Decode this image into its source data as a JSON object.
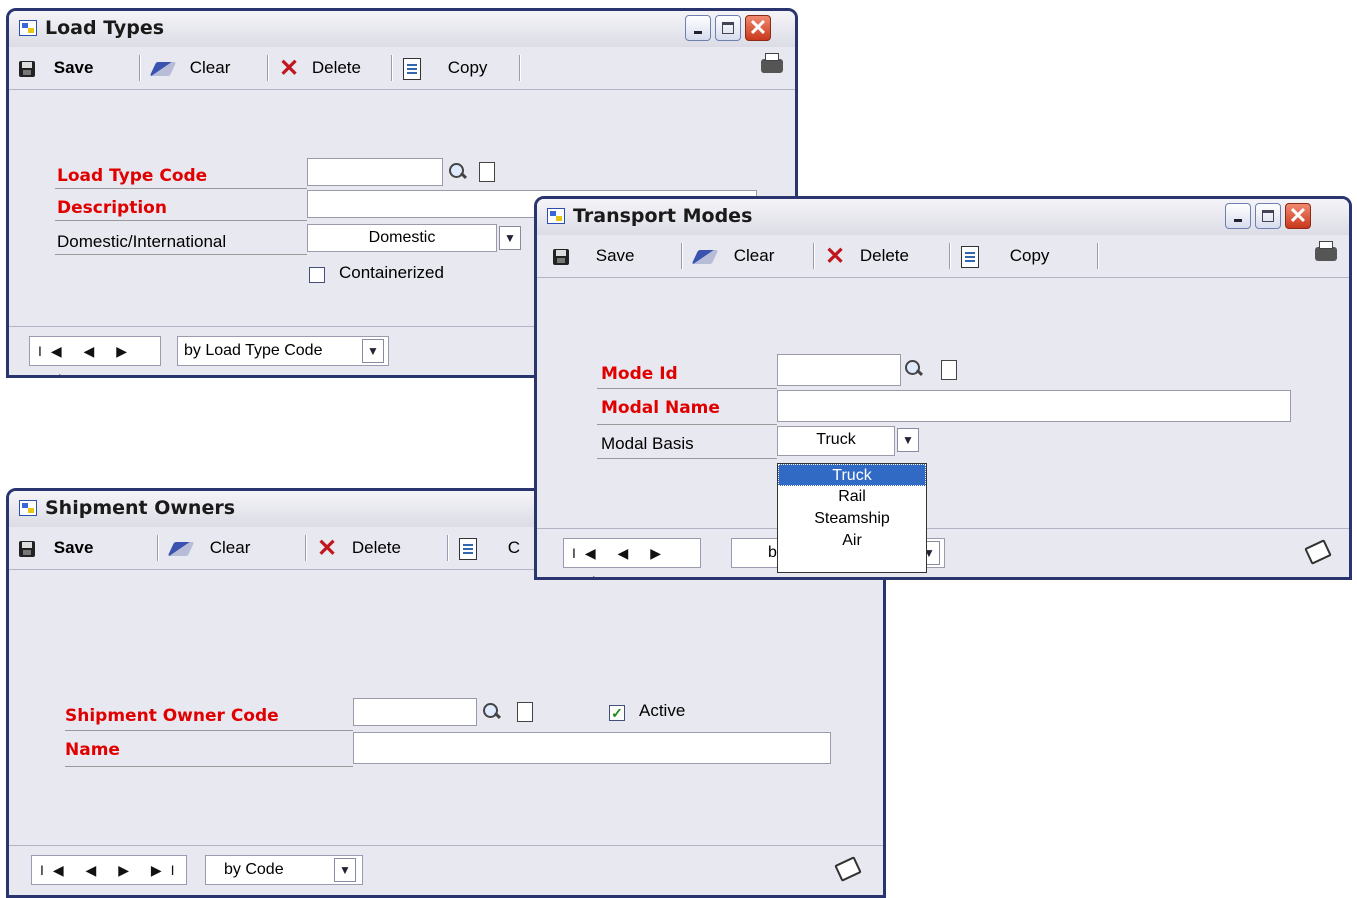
{
  "toolbar": {
    "save": "Save",
    "clear": "Clear",
    "delete": "Delete",
    "copy": "Copy"
  },
  "load_types": {
    "title": "Load Types",
    "labels": {
      "code": "Load Type Code",
      "description": "Description",
      "dom_intl": "Domestic/International",
      "containerized": "Containerized"
    },
    "values": {
      "code": "",
      "description": "",
      "dom_intl": "Domestic"
    },
    "nav": "I◀ ◀ ▶ ▶I",
    "sort": "by Load Type Code"
  },
  "transport_modes": {
    "title": "Transport Modes",
    "labels": {
      "mode_id": "Mode Id",
      "modal_name": "Modal Name",
      "modal_basis": "Modal Basis"
    },
    "values": {
      "mode_id": "",
      "modal_name": "",
      "modal_basis": "Truck"
    },
    "dropdown_options": [
      "Truck",
      "Rail",
      "Steamship",
      "Air"
    ],
    "nav": "I◀ ◀ ▶ ▶I",
    "sort_fragment": "b"
  },
  "shipment_owners": {
    "title": "Shipment Owners",
    "labels": {
      "code": "Shipment Owner Code",
      "name": "Name",
      "active": "Active"
    },
    "values": {
      "code": "",
      "name": "",
      "active_checked": true
    },
    "toolbar_copy_fragment": "C",
    "nav": "I◀ ◀ ▶ ▶I",
    "sort": "by Code"
  },
  "icons": [
    "save-icon",
    "clear-icon",
    "delete-icon",
    "copy-icon",
    "print-icon",
    "lookup-icon",
    "note-icon",
    "dropdown-arrow-icon",
    "attachment-note-icon"
  ]
}
